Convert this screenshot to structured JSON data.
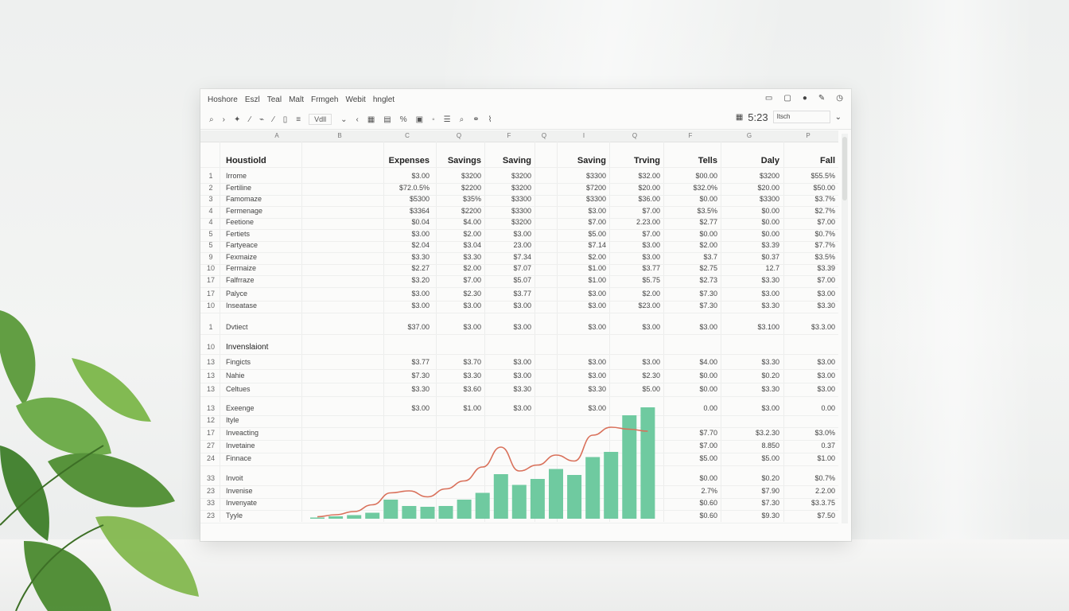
{
  "menu": [
    "Hoshore",
    "Eszl",
    "Teal",
    "Malt",
    "Frmgeh",
    "Webit",
    "hnglet"
  ],
  "toolbar_icons": [
    "search-icon",
    "arrow-right-icon",
    "pin-icon",
    "pen-icon",
    "brush-icon",
    "pencil-icon",
    "document-icon",
    "list-icon",
    "box-icon",
    "chevron-icon",
    "code-icon",
    "grid-icon",
    "table-icon",
    "percent-icon",
    "print-icon",
    "circle-icon",
    "align-icon",
    "zoom-icon",
    "link-icon",
    "clip-icon"
  ],
  "toolbar_box": "Vdll",
  "zoom": {
    "value": "5:23",
    "select": "Itsch"
  },
  "column_letters": [
    "A",
    "B",
    "C",
    "Q",
    "F",
    "Q",
    "I",
    "Q",
    "F",
    "G",
    "P"
  ],
  "header_row": {
    "label": "Houstiold",
    "cols": [
      "Expenses",
      "Savings",
      "Saving",
      "Saving",
      "Trving",
      "Tells",
      "Daly",
      "Fall"
    ]
  },
  "rows": [
    {
      "n": "1",
      "label": "Irrome",
      "v": [
        "$3.00",
        "$3200",
        "$3200",
        "$3300",
        "$32.00",
        "$00.00",
        "$3200",
        "$55.5%"
      ]
    },
    {
      "n": "2",
      "label": "Fertiline",
      "v": [
        "$72.0.5%",
        "$2200",
        "$3200",
        "$7200",
        "$20.00",
        "$32.0%",
        "$20.00",
        "$50.00"
      ]
    },
    {
      "n": "3",
      "label": "Famomaze",
      "v": [
        "$5300",
        "$35%",
        "$3300",
        "$3300",
        "$36.00",
        "$0.00",
        "$3300",
        "$3.7%"
      ]
    },
    {
      "n": "4",
      "label": "Fermenage",
      "v": [
        "$3364",
        "$2200",
        "$3300",
        "$3.00",
        "$7.00",
        "$3.5%",
        "$0.00",
        "$2.7%"
      ]
    },
    {
      "n": "4",
      "label": "Feetione",
      "v": [
        "$0.04",
        "$4.00",
        "$3200",
        "$7.00",
        "2.23.00",
        "$2.77",
        "$0.00",
        "$7.00"
      ]
    },
    {
      "n": "5",
      "label": "Fertiets",
      "v": [
        "$3.00",
        "$2.00",
        "$3.00",
        "$5.00",
        "$7.00",
        "$0.00",
        "$0.00",
        "$0.7%"
      ]
    },
    {
      "n": "5",
      "label": "Fartyeace",
      "v": [
        "$2.04",
        "$3.04",
        "23.00",
        "$7.14",
        "$3.00",
        "$2.00",
        "$3.39",
        "$7.7%"
      ]
    },
    {
      "n": "9",
      "label": "Fexmaize",
      "v": [
        "$3.30",
        "$3.30",
        "$7.34",
        "$2.00",
        "$3.00",
        "$3.7",
        "$0.37",
        "$3.5%"
      ]
    },
    {
      "n": "10",
      "label": "Ferrnaize",
      "v": [
        "$2.27",
        "$2.00",
        "$7.07",
        "$1.00",
        "$3.77",
        "$2.75",
        "12.7",
        "$3.39"
      ]
    },
    {
      "n": "17",
      "label": "Falfrraze",
      "v": [
        "$3.20",
        "$7.00",
        "$5.07",
        "$1.00",
        "$5.75",
        "$2.73",
        "$3.30",
        "$7.00"
      ]
    },
    {
      "n": "17",
      "label": "Palyce",
      "v": [
        "$3.00",
        "$2.30",
        "$3.77",
        "$3.00",
        "$2.00",
        "$7.30",
        "$3.00",
        "$3.00"
      ]
    },
    {
      "n": "10",
      "label": "Inseatase",
      "v": [
        "$3.00",
        "$3.00",
        "$3.00",
        "$3.00",
        "$23.00",
        "$7.30",
        "$3.30",
        "$3.30"
      ]
    }
  ],
  "divest_row": {
    "n": "1",
    "label": "Dvtiect",
    "v": [
      "$37.00",
      "$3.00",
      "$3.00",
      "$3.00",
      "$3.00",
      "$3.00",
      "$3.100",
      "$3.3.00"
    ]
  },
  "investment_section": {
    "n": "10",
    "label": "Invenslaiont"
  },
  "investment_rows": [
    {
      "n": "13",
      "label": "Fingicts",
      "v": [
        "$3.77",
        "$3.70",
        "$3.00",
        "$3.00",
        "$3.00",
        "$4.00",
        "$3.30",
        "$3.00"
      ]
    },
    {
      "n": "13",
      "label": "Nahie",
      "v": [
        "$7.30",
        "$3.30",
        "$3.00",
        "$3.00",
        "$2.30",
        "$0.00",
        "$0.20",
        "$3.00"
      ]
    },
    {
      "n": "13",
      "label": "Celtues",
      "v": [
        "$3.30",
        "$3.60",
        "$3.30",
        "$3.30",
        "$5.00",
        "$0.00",
        "$3.30",
        "$3.00"
      ]
    }
  ],
  "expense_row": {
    "n": "13",
    "label": "Exeenge",
    "v": [
      "$3.00",
      "$1.00",
      "$3.00",
      "$3.00",
      "",
      "0.00",
      "$3.00",
      "0.00"
    ]
  },
  "lower_rows": [
    {
      "n": "12",
      "label": "Ityle",
      "v": [
        "",
        "",
        ""
      ]
    },
    {
      "n": "17",
      "label": "Inveacting",
      "v": [
        "$7.70",
        "$3.2.30",
        "$3.0%"
      ]
    },
    {
      "n": "27",
      "label": "Invetaine",
      "v": [
        "$7.00",
        "8.850",
        "0.37"
      ]
    },
    {
      "n": "24",
      "label": "Finnace",
      "v": [
        "$5.00",
        "$5.00",
        "$1.00"
      ]
    },
    {
      "n": "33",
      "label": "Invoit",
      "v": [
        "$0.00",
        "$0.20",
        "$0.7%"
      ]
    },
    {
      "n": "23",
      "label": "Invenise",
      "v": [
        "2.7%",
        "$7.90",
        "2.2.00"
      ]
    },
    {
      "n": "33",
      "label": "Invenyate",
      "v": [
        "$0.60",
        "$7.30",
        "$3.3.75"
      ]
    },
    {
      "n": "23",
      "label": "Tyyle",
      "v": [
        "$0.60",
        "$9.30",
        "$7.50"
      ]
    }
  ],
  "chart_data": {
    "type": "bar",
    "values": [
      0.3,
      0.6,
      0.9,
      1.5,
      4.8,
      3.2,
      3.0,
      3.2,
      4.8,
      6.5,
      11.2,
      8.5,
      10.0,
      12.5,
      11.0,
      15.5,
      16.8,
      26.0,
      28.0
    ],
    "line": [
      0.5,
      1.0,
      1.8,
      3.5,
      6.5,
      7.0,
      5.5,
      7.5,
      9.5,
      13.0,
      18.0,
      12.0,
      13.5,
      16.0,
      14.5,
      21.0,
      23.0,
      22.5,
      22.0
    ],
    "colors": {
      "bar": "#6fcaa0",
      "line": "#d9705a"
    }
  }
}
